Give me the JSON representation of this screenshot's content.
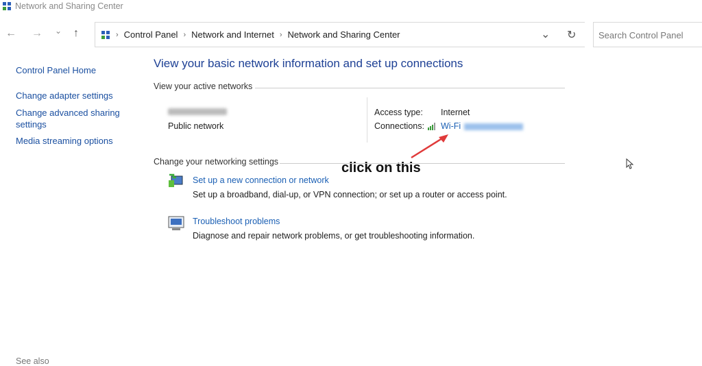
{
  "window": {
    "title": "Network and Sharing Center"
  },
  "toolbar": {
    "back": "←",
    "forward": "→",
    "recent": "⌄",
    "up": "↑",
    "dropdown": "⌄",
    "refresh": "↻"
  },
  "breadcrumb": [
    "Control Panel",
    "Network and Internet",
    "Network and Sharing Center"
  ],
  "search": {
    "placeholder": "Search Control Panel"
  },
  "sidebar": {
    "items": [
      "Control Panel Home",
      "Change adapter settings",
      "Change advanced sharing settings",
      "Media streaming options"
    ],
    "see_also": "See also"
  },
  "main": {
    "heading": "View your basic network information and set up connections",
    "active_networks": "View your active networks",
    "network_type": "Public network",
    "access_type_label": "Access type:",
    "access_type_value": "Internet",
    "connections_label": "Connections:",
    "connection_link": "Wi-Fi",
    "change_settings": "Change your networking settings",
    "tasks": [
      {
        "link": "Set up a new connection or network",
        "desc": "Set up a broadband, dial-up, or VPN connection; or set up a router or access point."
      },
      {
        "link": "Troubleshoot problems",
        "desc": "Diagnose and repair network problems, or get troubleshooting information."
      }
    ]
  },
  "annotation": {
    "text": "click on this",
    "arrow_color": "#e03a3a"
  }
}
